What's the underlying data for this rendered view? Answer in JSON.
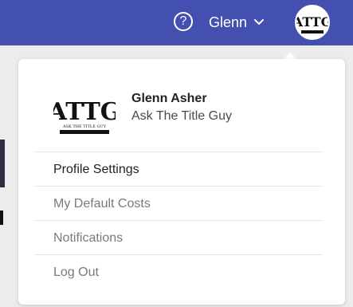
{
  "header": {
    "help_label": "?",
    "user_name": "Glenn",
    "avatar_text": "ATTG"
  },
  "profile": {
    "name": "Glenn Asher",
    "company": "Ask The Title Guy",
    "logo_text": "ATTG",
    "logo_caption": "ASK THE TITLE GUY"
  },
  "menu": {
    "items": [
      {
        "label": "Profile Settings"
      },
      {
        "label": "My Default Costs"
      },
      {
        "label": "Notifications"
      },
      {
        "label": "Log Out"
      }
    ]
  },
  "colors": {
    "topbar": "#4350b0",
    "text_primary": "#232323",
    "text_muted": "#7a7a7a"
  }
}
